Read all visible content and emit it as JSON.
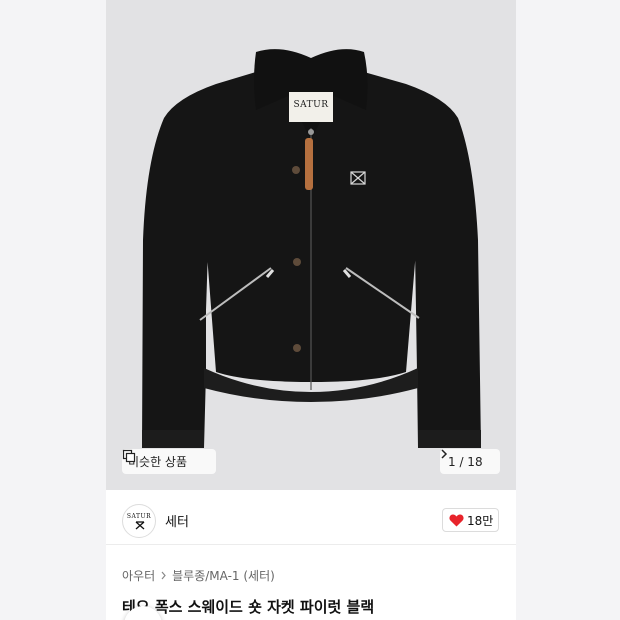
{
  "product": {
    "image_alt": "Black wool jacket",
    "patch_text": "SATUR",
    "similar_label": "비슷한 상품",
    "image_counter": "1 / 18",
    "title": "테오 폭스 스웨이드 숏 자켓 파이럿 블랙"
  },
  "brand": {
    "logo_text": "SATUR",
    "name": "세터",
    "likes": "18만"
  },
  "breadcrumb": {
    "items": [
      "아우터",
      "블루종/MA-1 (세터)"
    ]
  },
  "colors": {
    "like_heart": "#e8242b",
    "jacket": "#151515",
    "background": "#e2e2e4"
  }
}
